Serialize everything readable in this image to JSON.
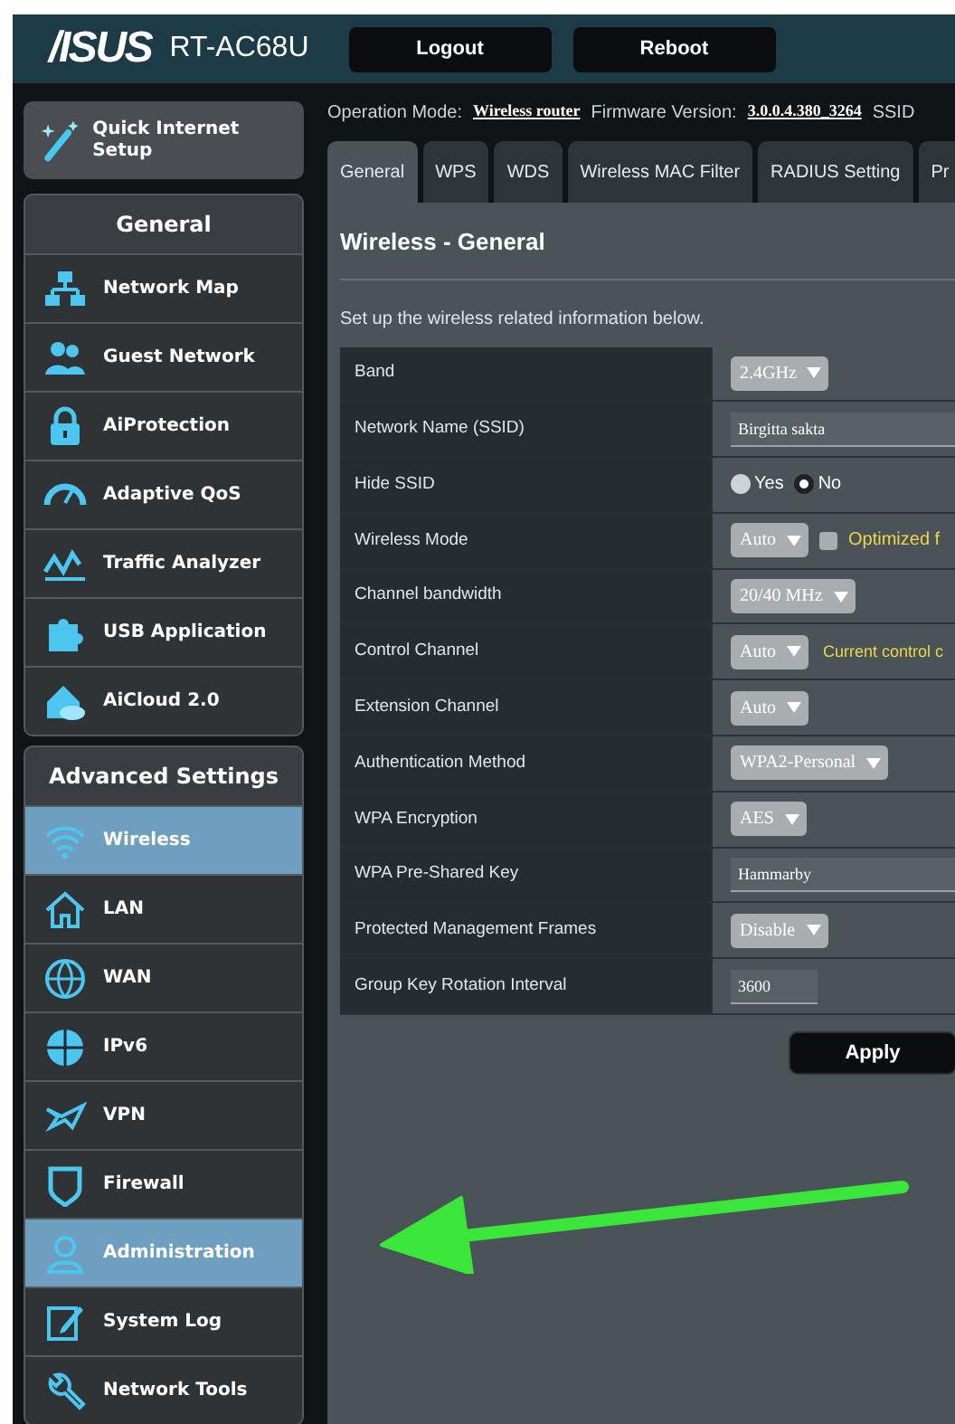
{
  "header": {
    "logo": "/ISUS",
    "model": "RT-AC68U",
    "buttons": [
      "Logout",
      "Reboot"
    ]
  },
  "info": {
    "mode_label": "Operation Mode:",
    "mode": "Wireless router",
    "firmware_label": "Firmware Version:",
    "firmware": "3.0.0.4.380_3264",
    "ssid_label": "SSID"
  },
  "quick_setup": {
    "label": "Quick Internet Setup"
  },
  "sidebar": {
    "general": {
      "title": "General",
      "items": [
        {
          "label": "Network Map",
          "selected": false
        },
        {
          "label": "Guest Network",
          "selected": false
        },
        {
          "label": "AiProtection",
          "selected": false
        },
        {
          "label": "Adaptive QoS",
          "selected": false
        },
        {
          "label": "Traffic Analyzer",
          "selected": false
        },
        {
          "label": "USB Application",
          "selected": false
        },
        {
          "label": "AiCloud 2.0",
          "selected": false
        }
      ]
    },
    "advanced": {
      "title": "Advanced Settings",
      "items": [
        {
          "label": "Wireless",
          "selected": true
        },
        {
          "label": "LAN",
          "selected": false
        },
        {
          "label": "WAN",
          "selected": false
        },
        {
          "label": "IPv6",
          "selected": false
        },
        {
          "label": "VPN",
          "selected": false
        },
        {
          "label": "Firewall",
          "selected": false
        },
        {
          "label": "Administration",
          "selected": true
        },
        {
          "label": "System Log",
          "selected": false
        },
        {
          "label": "Network Tools",
          "selected": false
        }
      ]
    }
  },
  "tabs": [
    {
      "label": "General",
      "selected": true
    },
    {
      "label": "WPS",
      "selected": false
    },
    {
      "label": "WDS",
      "selected": false
    },
    {
      "label": "Wireless MAC Filter",
      "selected": false
    },
    {
      "label": "RADIUS Setting",
      "selected": false
    },
    {
      "label": "Pr",
      "selected": false
    }
  ],
  "page": {
    "title": "Wireless - General",
    "description": "Set up the wireless related information below."
  },
  "rows": [
    {
      "label": "Band",
      "kind": "select",
      "value": "2.4GHz"
    },
    {
      "label": "Network Name (SSID)",
      "kind": "text",
      "value": "Birgitta sakta"
    },
    {
      "label": "Hide SSID",
      "kind": "radio",
      "options": [
        {
          "label": "Yes",
          "selected": false
        },
        {
          "label": "No",
          "selected": true
        }
      ]
    },
    {
      "label": "Wireless Mode",
      "kind": "select",
      "value": "Auto",
      "checkbox": {
        "label": "Optimized f",
        "checked": false
      }
    },
    {
      "label": "Channel bandwidth",
      "kind": "select",
      "value": "20/40 MHz"
    },
    {
      "label": "Control Channel",
      "kind": "select",
      "value": "Auto",
      "note": "Current control c"
    },
    {
      "label": "Extension Channel",
      "kind": "select",
      "value": "Auto"
    },
    {
      "label": "Authentication Method",
      "kind": "select",
      "value": "WPA2-Personal"
    },
    {
      "label": "WPA Encryption",
      "kind": "select",
      "value": "AES"
    },
    {
      "label": "WPA Pre-Shared Key",
      "kind": "text",
      "value": "Hammarby"
    },
    {
      "label": "Protected Management Frames",
      "kind": "select",
      "value": "Disable"
    },
    {
      "label": "Group Key Rotation Interval",
      "kind": "short",
      "value": "3600"
    }
  ],
  "apply": "Apply"
}
